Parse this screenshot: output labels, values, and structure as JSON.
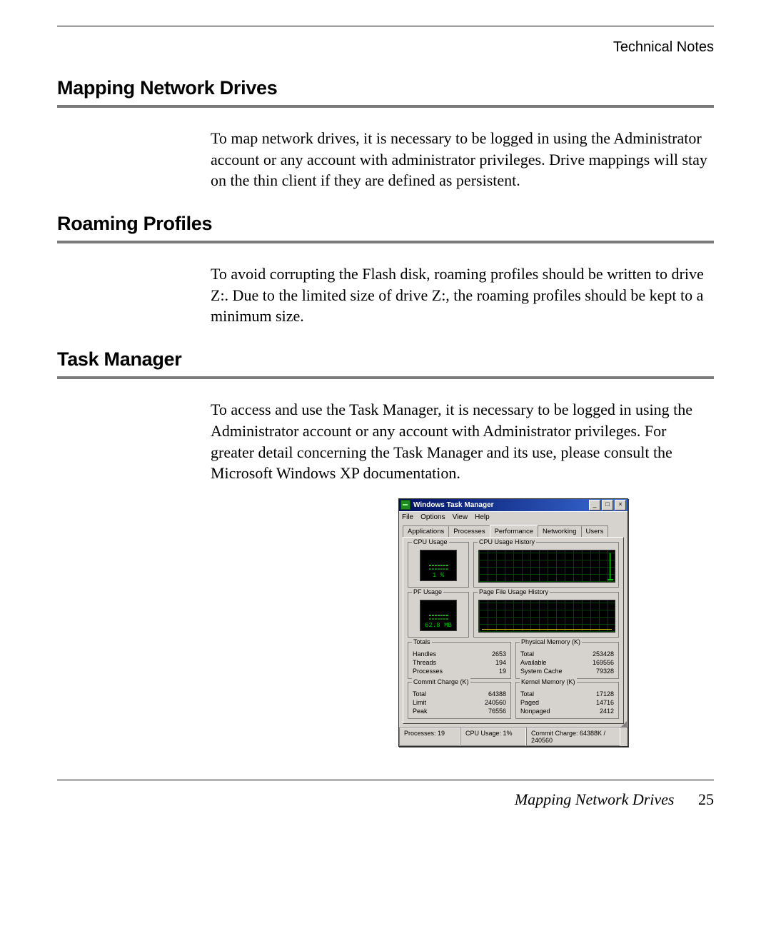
{
  "header": {
    "right_label": "Technical Notes"
  },
  "sections": {
    "s1": {
      "title": "Mapping Network Drives",
      "body": "To map network drives, it is necessary to be logged in using the Administrator account or any account with administrator privileges. Drive mappings will stay on the thin client if they are defined as persistent."
    },
    "s2": {
      "title": "Roaming Profiles",
      "body": "To avoid corrupting the Flash disk, roaming profiles should be written to drive Z:. Due to the limited size of drive Z:, the roaming profiles should be kept to a minimum size."
    },
    "s3": {
      "title": "Task Manager",
      "body": "To access and use the Task Manager, it is necessary to be logged in using the Administrator account or any account with Administrator privileges. For greater detail concerning the Task Manager and its use, please consult the Microsoft Windows XP documentation."
    }
  },
  "task_manager": {
    "window_title": "Windows Task Manager",
    "buttons": {
      "min": "_",
      "max": "□",
      "close": "×"
    },
    "menu": [
      "File",
      "Options",
      "View",
      "Help"
    ],
    "tabs": [
      "Applications",
      "Processes",
      "Performance",
      "Networking",
      "Users"
    ],
    "active_tab_index": 2,
    "groups": {
      "cpu_usage": {
        "title": "CPU Usage",
        "value": "1 %"
      },
      "cpu_history": {
        "title": "CPU Usage History"
      },
      "pf_usage": {
        "title": "PF Usage",
        "value": "62.8 MB"
      },
      "pf_history": {
        "title": "Page File Usage History"
      },
      "totals": {
        "title": "Totals",
        "rows": [
          {
            "k": "Handles",
            "v": "2653"
          },
          {
            "k": "Threads",
            "v": "194"
          },
          {
            "k": "Processes",
            "v": "19"
          }
        ]
      },
      "phys_mem": {
        "title": "Physical Memory (K)",
        "rows": [
          {
            "k": "Total",
            "v": "253428"
          },
          {
            "k": "Available",
            "v": "169556"
          },
          {
            "k": "System Cache",
            "v": "79328"
          }
        ]
      },
      "commit": {
        "title": "Commit Charge (K)",
        "rows": [
          {
            "k": "Total",
            "v": "64388"
          },
          {
            "k": "Limit",
            "v": "240560"
          },
          {
            "k": "Peak",
            "v": "76556"
          }
        ]
      },
      "kernel": {
        "title": "Kernel Memory (K)",
        "rows": [
          {
            "k": "Total",
            "v": "17128"
          },
          {
            "k": "Paged",
            "v": "14716"
          },
          {
            "k": "Nonpaged",
            "v": "2412"
          }
        ]
      }
    },
    "status": {
      "processes": "Processes: 19",
      "cpu": "CPU Usage: 1%",
      "commit": "Commit Charge: 64388K / 240560"
    }
  },
  "footer": {
    "title": "Mapping Network Drives",
    "page": "25"
  }
}
